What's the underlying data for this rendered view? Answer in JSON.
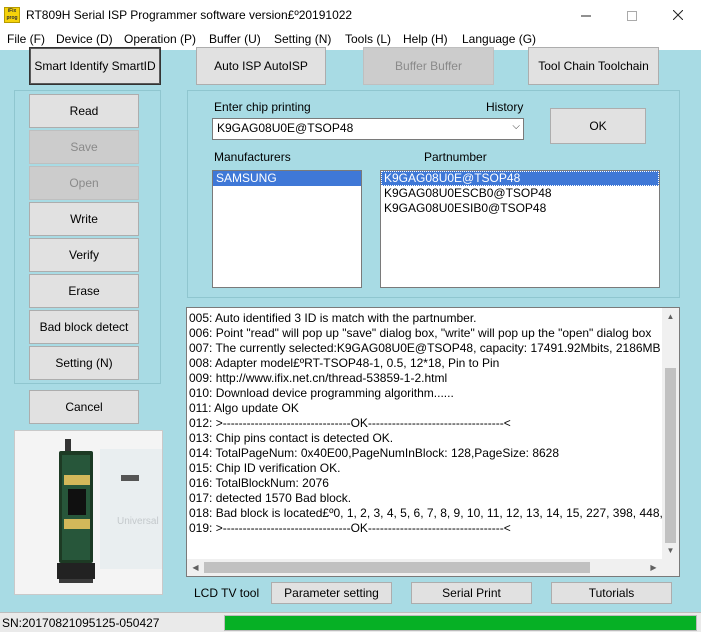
{
  "window": {
    "title": "RT809H Serial ISP Programmer software version£º20191022",
    "icon_text": "iFix prog",
    "minimize_icon": "minimize-icon",
    "maximize_icon": "maximize-icon",
    "close_icon": "close-icon"
  },
  "menu": [
    "File (F)",
    "Device (D)",
    "Operation (P)",
    "Buffer (U)",
    "Setting (N)",
    "Tools (L)",
    "Help (H)",
    "Language (G)"
  ],
  "toolbar": {
    "smart_identify": "Smart Identify SmartID",
    "auto_isp": "Auto ISP AutoISP",
    "buffer": "Buffer Buffer",
    "tool_chain": "Tool Chain Toolchain"
  },
  "actions": {
    "read": "Read",
    "save": "Save",
    "open": "Open",
    "write": "Write",
    "verify": "Verify",
    "erase": "Erase",
    "bad_block": "Bad block detect",
    "setting": "Setting (N)",
    "cancel": "Cancel"
  },
  "chip_select": {
    "enter_label": "Enter chip printing",
    "history_label": "History",
    "value": "K9GAG08U0E@TSOP48",
    "ok": "OK",
    "manufacturers_label": "Manufacturers",
    "partnumber_label": "Partnumber",
    "manufacturers": [
      "SAMSUNG"
    ],
    "partnumbers": [
      "K9GAG08U0E@TSOP48",
      "K9GAG08U0ESCB0@TSOP48",
      "K9GAG08U0ESIB0@TSOP48"
    ]
  },
  "log": [
    "005:  Auto identified 3 ID is match with the partnumber.",
    "006:  Point \"read\" will pop up \"save\" dialog box, \"write\" will pop up the \"open\" dialog box",
    "007:  The currently selected:K9GAG08U0E@TSOP48, capacity: 17491.92Mbits, 2186MB",
    "008:  Adapter model£ºRT-TSOP48-1, 0.5, 12*18, Pin to Pin",
    "009:  http://www.ifix.net.cn/thread-53859-1-2.html",
    "010:  Download device programming algorithm......",
    "011:  Algo update OK",
    "012:  >--------------------------------OK----------------------------------<",
    "013:  Chip pins contact is detected OK.",
    "014:  TotalPageNum: 0x40E00,PageNumInBlock: 128,PageSize: 8628",
    "015:  Chip ID verification OK.",
    "016:  TotalBlockNum: 2076",
    "017:  detected 1570 Bad block.",
    "018:  Bad block is located£º0, 1, 2, 3, 4, 5, 6, 7, 8, 9, 10, 11, 12, 13, 14, 15, 227, 398, 448,",
    "019:  >--------------------------------OK----------------------------------<"
  ],
  "bottom": {
    "lcd_tv_tool": "LCD TV tool",
    "parameter_setting": "Parameter setting",
    "serial_print": "Serial Print",
    "tutorials": "Tutorials"
  },
  "photo": {
    "watermark": "Universal Programmer"
  },
  "status": {
    "sn": "SN:20170821095125-050427",
    "progress": 1.0,
    "progress_color": "#06b025"
  },
  "colors": {
    "client_bg": "#a8dbe4",
    "selection": "#3f78d7"
  }
}
